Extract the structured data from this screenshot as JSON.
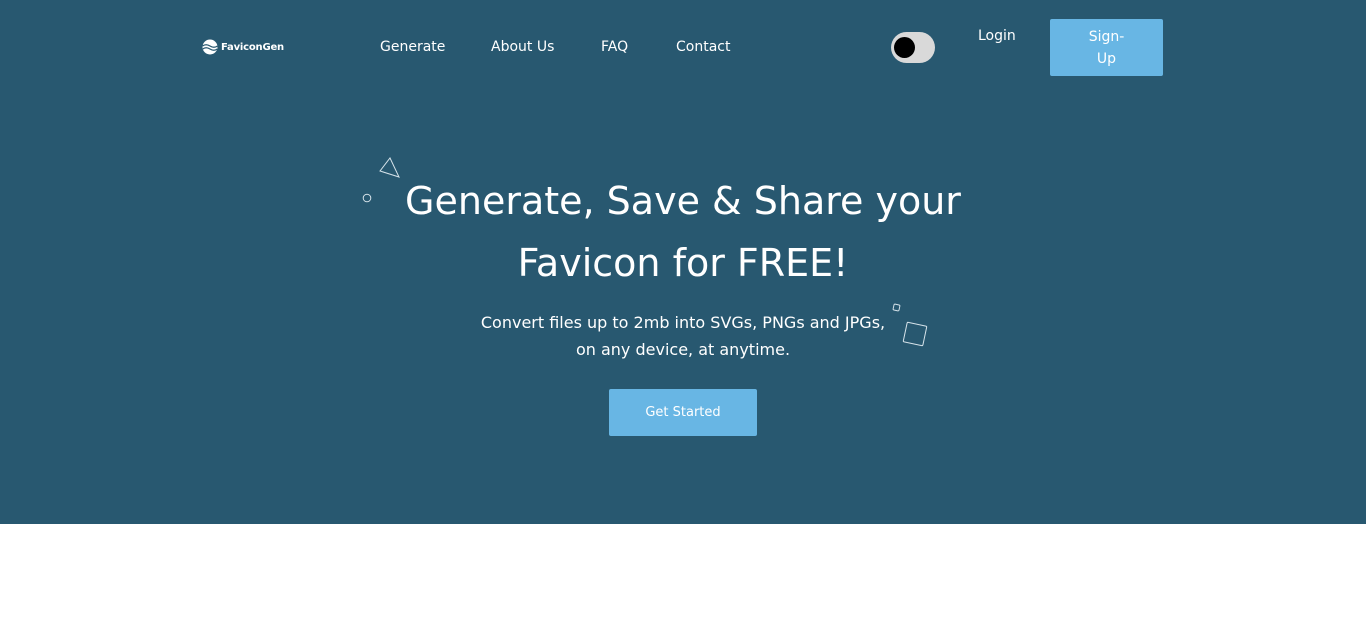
{
  "brand": {
    "name": "FaviconGen",
    "logo_icon": "globe-wave-icon"
  },
  "nav": {
    "links": [
      "Generate",
      "About Us",
      "FAQ",
      "Contact"
    ]
  },
  "header": {
    "theme_toggle_icon": "toggle-switch",
    "login_label": "Login",
    "signup_label": "Sign-Up"
  },
  "hero": {
    "headline_line1": "Generate, Save & Share your",
    "headline_line2": "Favicon for FREE!",
    "subtext_line1": "Convert files up to 2mb into SVGs, PNGs and JPGs,",
    "subtext_line2": "on any device, at anytime.",
    "cta_label": "Get Started"
  },
  "colors": {
    "hero_background": "#285870",
    "accent": "#68b6e4",
    "page_background": "#ffffff"
  }
}
